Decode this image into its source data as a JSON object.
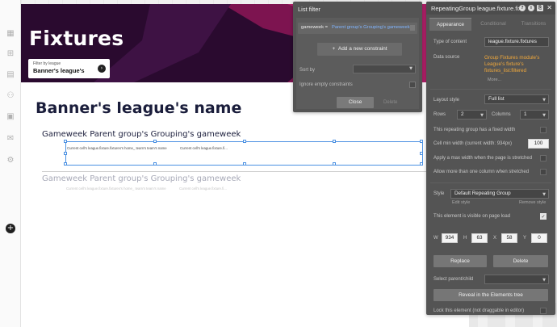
{
  "left_toolbar": {
    "icons": [
      "grid-icon",
      "tree-icon",
      "table-icon",
      "users-icon",
      "calendar-icon",
      "mail-icon",
      "gear-icon"
    ],
    "add_symbol": "+"
  },
  "page": {
    "hero_title": "Fixtures",
    "dropdown": {
      "label": "Filter by league",
      "value": "Banner's league's",
      "button_symbol": "›"
    },
    "league_heading": "Banner's league's name",
    "gameweek_heading": "Gameweek Parent group's Grouping's gameweek",
    "gameweek_heading_faded": "Gameweek Parent group's Grouping's gameweek",
    "cell_texts": {
      "home_team": "Current cell's league.fixture.fixtures's home_ team's team's name",
      "fixture_field": "Current cell's league.fixture.fi...",
      "home_team_faded": "Current cell's league.fixture.fixtures's home_ team's team's name",
      "fixture_field_faded": "Current cell's league.fixture.fi..."
    },
    "colors": {
      "hero_bg": "#2a0a2f",
      "hero_accent": "#a3195b",
      "heading_navy": "#1a1d3b",
      "selection_blue": "#4a90e2"
    }
  },
  "list_filter": {
    "title": "List filter",
    "constraint": {
      "key": "gameweek =",
      "value": "Parent group's Grouping's gameweek"
    },
    "add_constraint_label": "Add a new constraint",
    "add_symbol": "+",
    "sort_by_label": "Sort by",
    "ignore_empty_label": "Ignore empty constraints",
    "close_label": "Close",
    "delete_label": "Delete"
  },
  "property_editor": {
    "title": "RepeatingGroup league.fixture.fixt",
    "header_icons": [
      "?",
      "i",
      "⎘"
    ],
    "close_symbol": "✕",
    "tabs": [
      {
        "label": "Appearance",
        "active": true
      },
      {
        "label": "Conditional",
        "active": false
      },
      {
        "label": "Transitions",
        "active": false
      }
    ],
    "type_of_content_label": "Type of content",
    "type_of_content_value": "league.fixture.fixtures",
    "data_source_label": "Data source",
    "data_source_value": "Group Fixtures module's League's fixture's fixtures_list:filtered",
    "more_label": "More...",
    "layout_style_label": "Layout style",
    "layout_style_value": "Full list",
    "rows_label": "Rows",
    "rows_value": "2",
    "columns_label": "Columns",
    "columns_value": "1",
    "fixed_width_label": "This repeating group has a fixed width",
    "cell_min_width_label": "Cell min width (current width: 934px)",
    "cell_min_width_value": "100",
    "max_width_label": "Apply a max width when the page is stretched",
    "multi_column_label": "Allow more than one column when stretched",
    "style_label": "Style",
    "style_value": "Default Repeating Group",
    "edit_style_label": "Edit style",
    "remove_style_label": "Remove style",
    "visible_label": "This element is visible on page load",
    "visible_checked": true,
    "geometry": {
      "w_label": "W",
      "w_value": "934",
      "h_label": "H",
      "h_value": "63",
      "x_label": "X",
      "x_value": "58",
      "y_label": "Y",
      "y_value": "0"
    },
    "replace_label": "Replace",
    "delete_label": "Delete",
    "select_parent_label": "Select parent/child",
    "reveal_label": "Reveal in the Elements tree",
    "lock_label": "Lock this element (not draggable in editor)",
    "check_symbol": "✓"
  }
}
